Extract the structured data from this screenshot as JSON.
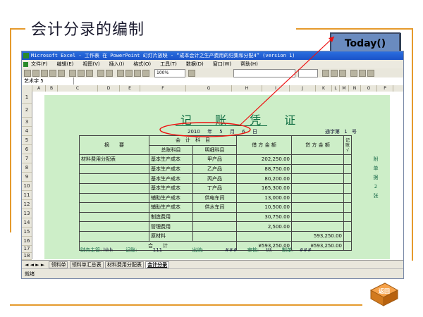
{
  "slide": {
    "title": "会计分录的编制",
    "callout": "Today()"
  },
  "excel": {
    "title": "Microsoft Excel - 工作表 在 PowerPoint 幻灯片放映 - “成本会计之生产费用的归集和分配4” (version 1)",
    "menu": [
      "文件(F)",
      "编辑(E)",
      "视图(V)",
      "插入(I)",
      "格式(O)",
      "工具(T)",
      "数据(D)",
      "窗口(W)",
      "帮助(H)"
    ],
    "zoom": "100%",
    "name_box": "艺术字 5",
    "columns": [
      "A",
      "B",
      "C",
      "D",
      "E",
      "F",
      "G",
      "H",
      "I",
      "J",
      "K",
      "L",
      "M",
      "N",
      "O",
      "P"
    ],
    "rows": [
      "1",
      "2",
      "3",
      "4",
      "5",
      "6",
      "7",
      "8",
      "9",
      "10",
      "11",
      "12",
      "13",
      "14",
      "15",
      "16",
      "17",
      "18"
    ],
    "sheet_tabs": [
      "领料单",
      "领料单汇总表",
      "材料费用分配表",
      "会计分录"
    ],
    "active_tab": "会计分录",
    "status": "就绪"
  },
  "voucher": {
    "title": "记 账 凭 证",
    "date_year": "2010",
    "date_label_year": "年",
    "date_month": "5",
    "date_label_month": "月",
    "date_day": "6",
    "date_label_day": "日",
    "number_label": "通字第",
    "number": "1",
    "number_suffix": "号",
    "headers": {
      "summary": "摘　　要",
      "account": "会　计　科　目",
      "general": "总账科目",
      "detail": "明细科目",
      "debit": "借 方 金 额",
      "credit": "贷 方 金 额",
      "posted": "记账√"
    },
    "rows": [
      {
        "summary": "材料费用分配表",
        "general": "基本生产成本",
        "detail": "甲产品",
        "debit": "202,250.00",
        "credit": ""
      },
      {
        "summary": "",
        "general": "基本生产成本",
        "detail": "乙产品",
        "debit": "88,750.00",
        "credit": ""
      },
      {
        "summary": "",
        "general": "基本生产成本",
        "detail": "丙产品",
        "debit": "80,200.00",
        "credit": ""
      },
      {
        "summary": "",
        "general": "基本生产成本",
        "detail": "丁产品",
        "debit": "165,300.00",
        "credit": ""
      },
      {
        "summary": "",
        "general": "辅助生产成本",
        "detail": "供电车间",
        "debit": "13,000.00",
        "credit": ""
      },
      {
        "summary": "",
        "general": "辅助生产成本",
        "detail": "供水车间",
        "debit": "10,500.00",
        "credit": ""
      },
      {
        "summary": "",
        "general": "制造费用",
        "detail": "",
        "debit": "30,750.00",
        "credit": ""
      },
      {
        "summary": "",
        "general": "管理费用",
        "detail": "",
        "debit": "2,500.00",
        "credit": ""
      },
      {
        "summary": "",
        "general": "原材料",
        "detail": "",
        "debit": "",
        "credit": "593,250.00"
      }
    ],
    "total_label": "合　　计",
    "total_debit": "¥593,250.00",
    "total_credit": "¥593,250.00",
    "side_note": [
      "附",
      "单",
      "据",
      "2",
      "张"
    ],
    "footer": {
      "supervisor_label": "财务主管:",
      "supervisor": "hhh",
      "bookkeeper_label": "记账:",
      "bookkeeper": "111",
      "cashier_label": "出纳:",
      "cashier": "###",
      "auditor_label": "审核:",
      "auditor": "ttt",
      "maker_label": "制单:",
      "maker": "###"
    }
  }
}
